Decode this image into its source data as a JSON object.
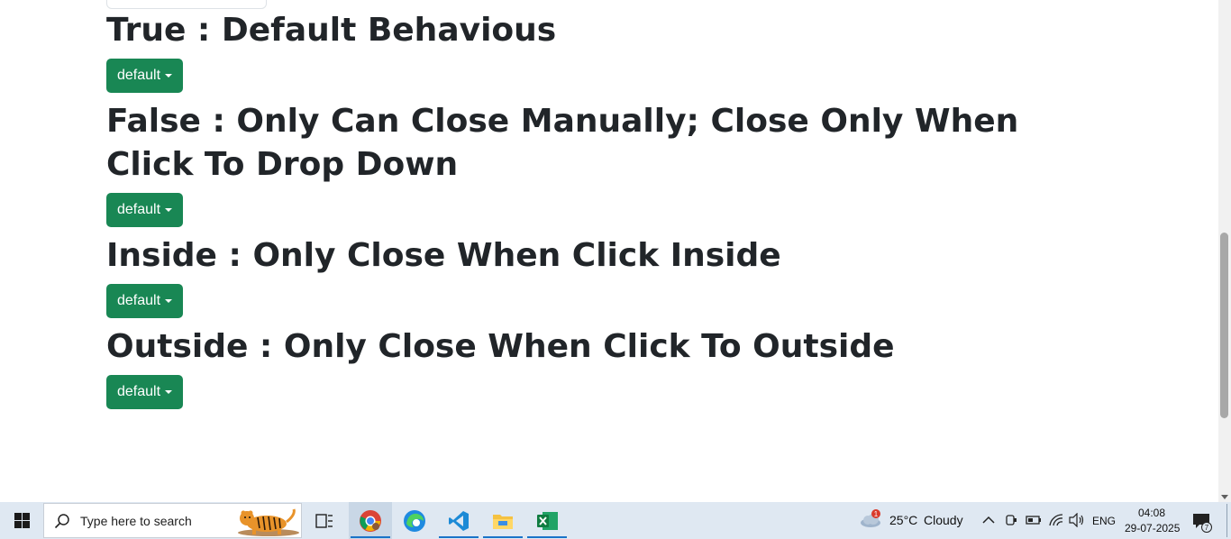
{
  "page": {
    "sections": [
      {
        "title": "True : Default Behavious",
        "button_label": "default"
      },
      {
        "title": "False : Only Can Close Manually; Close Only When Click To Drop Down",
        "button_label": "default"
      },
      {
        "title": "Inside : Only Close When Click Inside",
        "button_label": "default"
      },
      {
        "title": "Outside : Only Close When Click To Outside",
        "button_label": "default"
      }
    ],
    "accent_color": "#198754"
  },
  "taskbar": {
    "search_placeholder": "Type here to search",
    "apps": [
      "task-view-icon",
      "chrome-icon",
      "edge-icon",
      "vscode-icon",
      "file-explorer-icon",
      "excel-icon"
    ],
    "weather": {
      "badge": "1",
      "temperature": "25°C",
      "condition": "Cloudy"
    },
    "language": "ENG",
    "time": "04:08",
    "date": "29-07-2025",
    "notification_count": "7"
  }
}
